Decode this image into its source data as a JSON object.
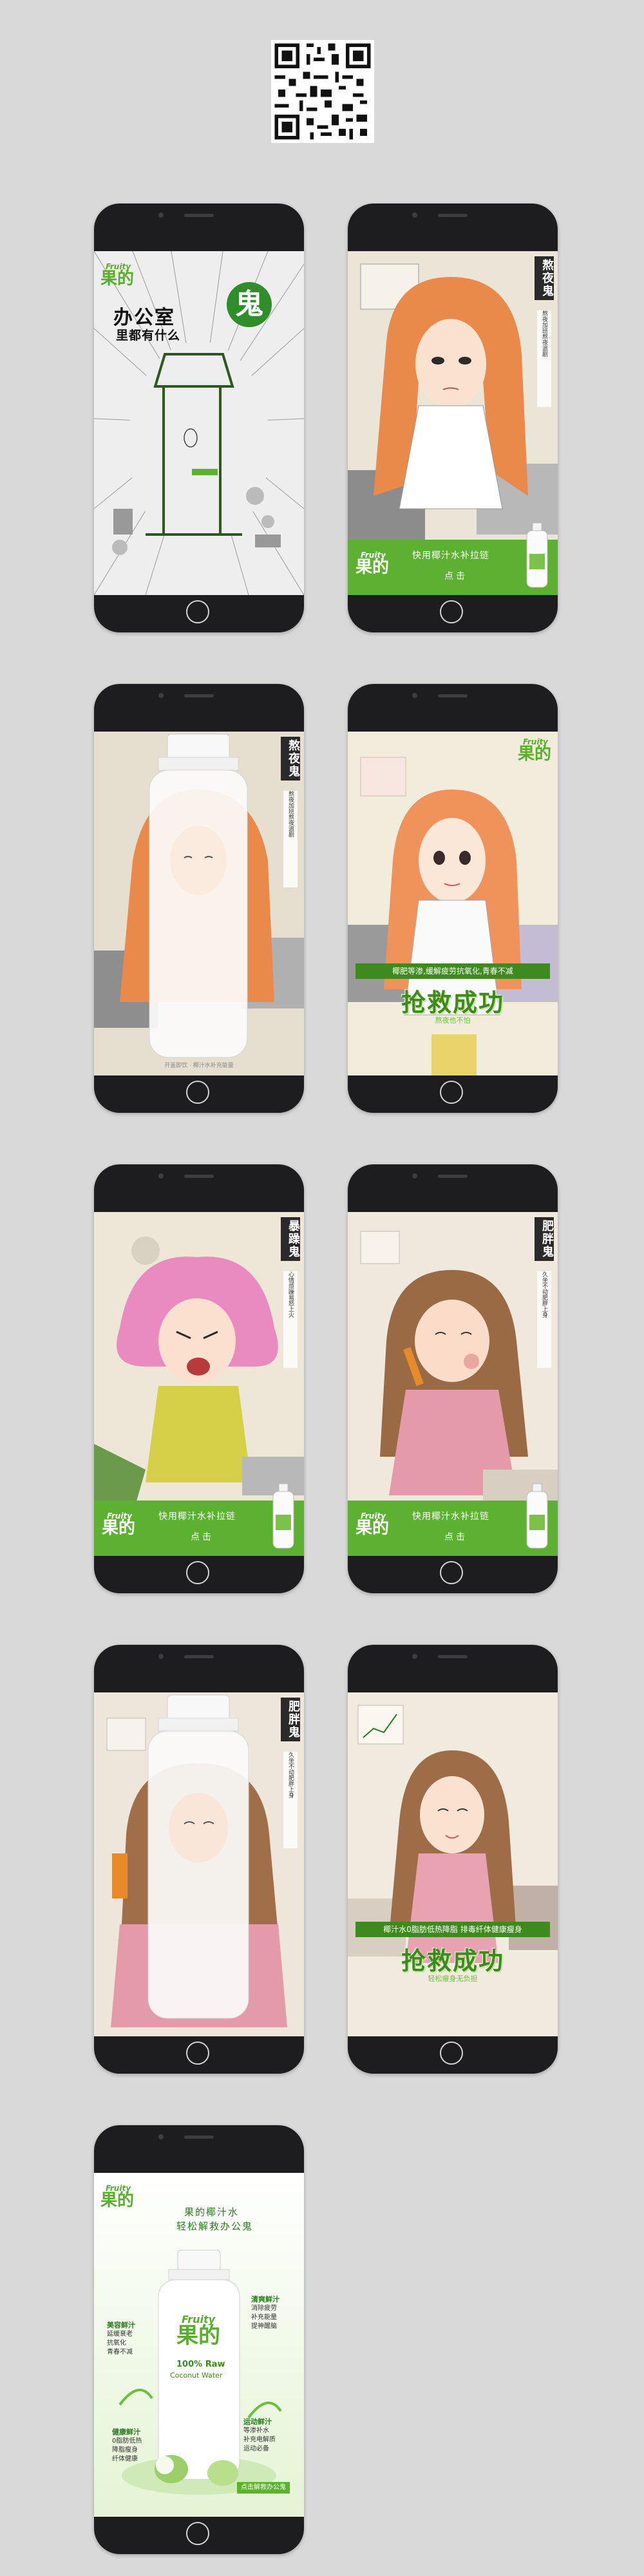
{
  "brand": {
    "english": "Fruity",
    "chinese": "果的"
  },
  "colors": {
    "brand_green": "#5cb130",
    "dark_green": "#3f8a1f",
    "phone_body": "#1d1d1f",
    "background": "#d9d9d9"
  },
  "icons": {
    "qr": "qr-code-icon",
    "home": "home-button-icon"
  },
  "screens": {
    "cover": {
      "title_main": "办公室",
      "title_sub": "里都有什么",
      "ghost_char": "鬼"
    },
    "night_ghost": {
      "label": "熬夜鬼",
      "description": "熬夜加班熬夜追剧",
      "cta_line1": "快用椰汁水补拉链",
      "cta_line2": "点击"
    },
    "night_bottle": {
      "label": "熬夜鬼",
      "description": "熬夜加班熬夜追剧",
      "caption": "开盖即饮 · 椰汁水补充能量"
    },
    "night_success": {
      "banner": "椰肥等渗,缓解疲劳抗氧化,青春不减",
      "success": "抢救成功",
      "sub": "熬夜也不怕"
    },
    "angry_ghost": {
      "label": "暴躁鬼",
      "description": "心情烦躁易怒上火",
      "cta_line1": "快用椰汁水补拉链",
      "cta_line2": "点击"
    },
    "fat_ghost": {
      "label": "肥胖鬼",
      "description": "久坐不动肥胖上身",
      "cta_line1": "快用椰汁水补拉链",
      "cta_line2": "点击"
    },
    "fat_bottle": {
      "label": "肥胖鬼",
      "description": "久坐不动肥胖上身"
    },
    "fat_success": {
      "banner": "椰汁水0脂肪低热降脂 排毒纤体健康瘦身",
      "success": "抢救成功",
      "sub": "轻松瘦身无负担"
    },
    "product": {
      "title1": "果的椰汁水",
      "title2": "轻松解救办公鬼",
      "bottle_brand_en": "Fruity",
      "bottle_brand_cn": "果的",
      "bottle_text1": "100% Raw",
      "bottle_text2": "Coconut Water",
      "features": [
        {
          "heading": "美容鲜汁",
          "lines": [
            "延缓衰老",
            "抗氧化",
            "青春不减"
          ]
        },
        {
          "heading": "清爽鲜汁",
          "lines": [
            "消除疲劳",
            "补充能量",
            "提神醒脑"
          ]
        },
        {
          "heading": "运动鲜汁",
          "lines": [
            "等渗补水",
            "补充电解质",
            "运动必备"
          ]
        },
        {
          "heading": "健康鲜汁",
          "lines": [
            "0脂肪低热",
            "降脂瘦身",
            "纤体健康"
          ]
        }
      ],
      "badge": "点击解救办公鬼"
    }
  }
}
